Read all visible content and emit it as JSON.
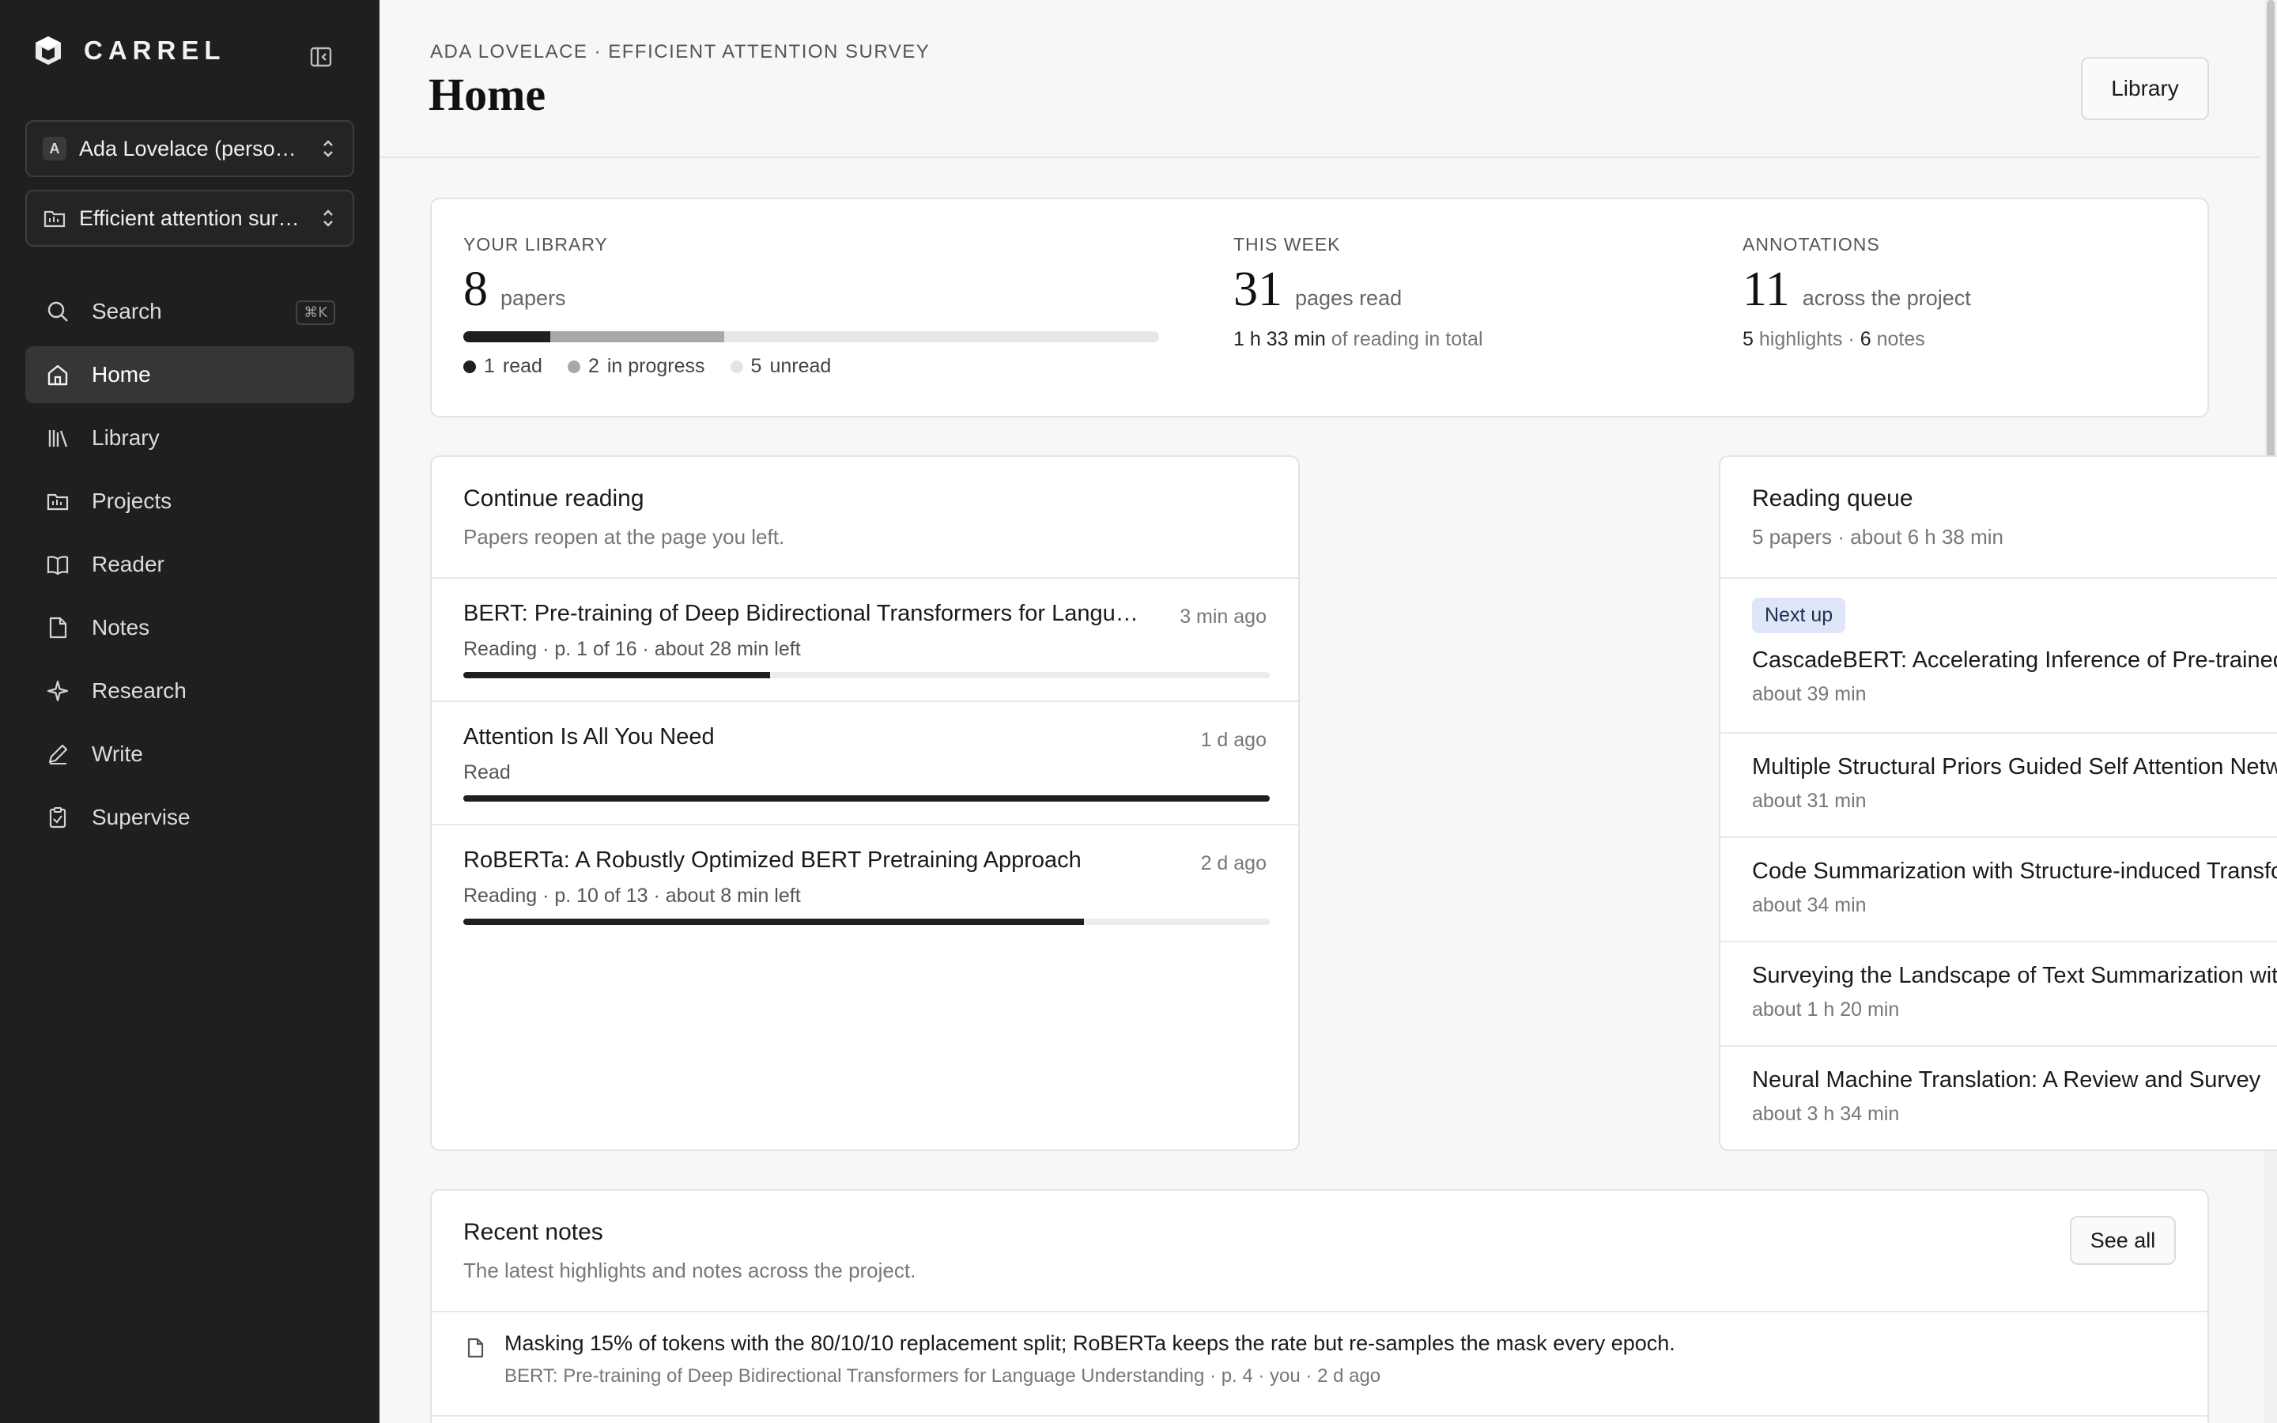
{
  "brand": {
    "name": "CARREL"
  },
  "sidebar": {
    "workspace": {
      "initial": "A",
      "label": "Ada Lovelace (personal)"
    },
    "project": {
      "label": "Efficient attention survey"
    },
    "search": {
      "label": "Search",
      "shortcut": "⌘K"
    },
    "items": [
      {
        "label": "Home",
        "icon": "home-icon"
      },
      {
        "label": "Library",
        "icon": "library-icon"
      },
      {
        "label": "Projects",
        "icon": "folder-icon"
      },
      {
        "label": "Reader",
        "icon": "book-icon"
      },
      {
        "label": "Notes",
        "icon": "note-icon"
      },
      {
        "label": "Research",
        "icon": "sparkle-icon"
      },
      {
        "label": "Write",
        "icon": "pen-icon"
      },
      {
        "label": "Supervise",
        "icon": "clipboard-icon"
      }
    ]
  },
  "header": {
    "breadcrumb": "ADA LOVELACE · EFFICIENT ATTENTION SURVEY",
    "title": "Home",
    "library_button": "Library"
  },
  "stats": {
    "library": {
      "label": "YOUR LIBRARY",
      "count": "8",
      "unit": "papers",
      "read": 1,
      "in_progress": 2,
      "unread": 5,
      "read_count": "1",
      "read_label": "read",
      "progress_count": "2",
      "progress_label": "in progress",
      "unread_count": "5",
      "unread_label": "unread",
      "colors": {
        "read": "#1f1f1f",
        "in_progress": "#a8a8a6",
        "unread": "#e4e4e2"
      }
    },
    "week": {
      "label": "THIS WEEK",
      "count": "31",
      "unit": "pages read",
      "time": "1 h 33 min",
      "time_suffix": "of reading in total"
    },
    "annotations": {
      "label": "ANNOTATIONS",
      "count": "11",
      "unit": "across the project",
      "highlights": "5",
      "highlights_label": "highlights ·",
      "notes": "6",
      "notes_label": "notes"
    }
  },
  "continue_reading": {
    "title": "Continue reading",
    "subtitle": "Papers reopen at the page you left.",
    "items": [
      {
        "title": "BERT: Pre-training of Deep Bidirectional Transformers for Language Understanding",
        "time": "3 min ago",
        "meta": "Reading · p. 1 of 16 · about 28 min left",
        "progress": 0.38
      },
      {
        "title": "Attention Is All You Need",
        "time": "1 d ago",
        "meta": "Read",
        "progress": 1.0
      },
      {
        "title": "RoBERTa: A Robustly Optimized BERT Pretraining Approach",
        "time": "2 d ago",
        "meta": "Reading · p. 10 of 13 · about 8 min left",
        "progress": 0.77
      }
    ]
  },
  "queue": {
    "title": "Reading queue",
    "subtitle": "5 papers · about 6 h 38 min",
    "badge": "Next up",
    "items": [
      {
        "title": "CascadeBERT: Accelerating Inference of Pre-trained Language Models via Calibrated Complete Models Cascade",
        "time": "about 39 min"
      },
      {
        "title": "Multiple Structural Priors Guided Self Attention Network for Language Understanding",
        "time": "about 31 min"
      },
      {
        "title": "Code Summarization with Structure-induced Transformer",
        "time": "about 34 min"
      },
      {
        "title": "Surveying the Landscape of Text Summarization with Deep Learning: A Comprehensive Review",
        "time": "about 1 h 20 min"
      },
      {
        "title": "Neural Machine Translation: A Review and Survey",
        "time": "about 3 h 34 min"
      }
    ]
  },
  "notes": {
    "title": "Recent notes",
    "subtitle": "The latest highlights and notes across the project.",
    "see_all": "See all",
    "items": [
      {
        "text": "Masking 15% of tokens with the 80/10/10 replacement split; RoBERTa keeps the rate but re-samples the mask every epoch.",
        "meta": "BERT: Pre-training of Deep Bidirectional Transformers for Language Understanding · p. 4 · you · 2 d ago"
      }
    ]
  }
}
